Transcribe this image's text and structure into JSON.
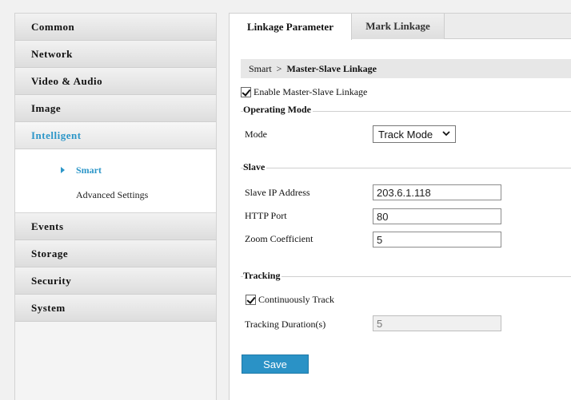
{
  "sidebar": {
    "items": [
      {
        "label": "Common"
      },
      {
        "label": "Network"
      },
      {
        "label": "Video & Audio"
      },
      {
        "label": "Image"
      },
      {
        "label": "Intelligent"
      },
      {
        "label": "Events"
      },
      {
        "label": "Storage"
      },
      {
        "label": "Security"
      },
      {
        "label": "System"
      }
    ],
    "submenu": [
      {
        "label": "Smart"
      },
      {
        "label": "Advanced Settings"
      }
    ]
  },
  "tabs": [
    {
      "label": "Linkage Parameter"
    },
    {
      "label": "Mark Linkage"
    }
  ],
  "breadcrumb": {
    "parent": "Smart",
    "separator": ">",
    "current": "Master-Slave Linkage"
  },
  "enable_checkbox": {
    "label": "Enable Master-Slave Linkage",
    "checked": true
  },
  "operating_mode": {
    "legend": "Operating Mode",
    "mode_label": "Mode",
    "mode_value": "Track Mode"
  },
  "slave": {
    "legend": "Slave",
    "ip_label": "Slave IP Address",
    "ip_value": "203.6.1.118",
    "port_label": "HTTP Port",
    "port_value": "80",
    "zoom_label": "Zoom Coefficient",
    "zoom_value": "5"
  },
  "tracking": {
    "legend": "Tracking",
    "continuous_label": "Continuously Track",
    "continuous_checked": true,
    "duration_label": "Tracking Duration(s)",
    "duration_value": "5"
  },
  "save_label": "Save",
  "colors": {
    "accent": "#2c96c8",
    "button": "#2a92c6"
  }
}
